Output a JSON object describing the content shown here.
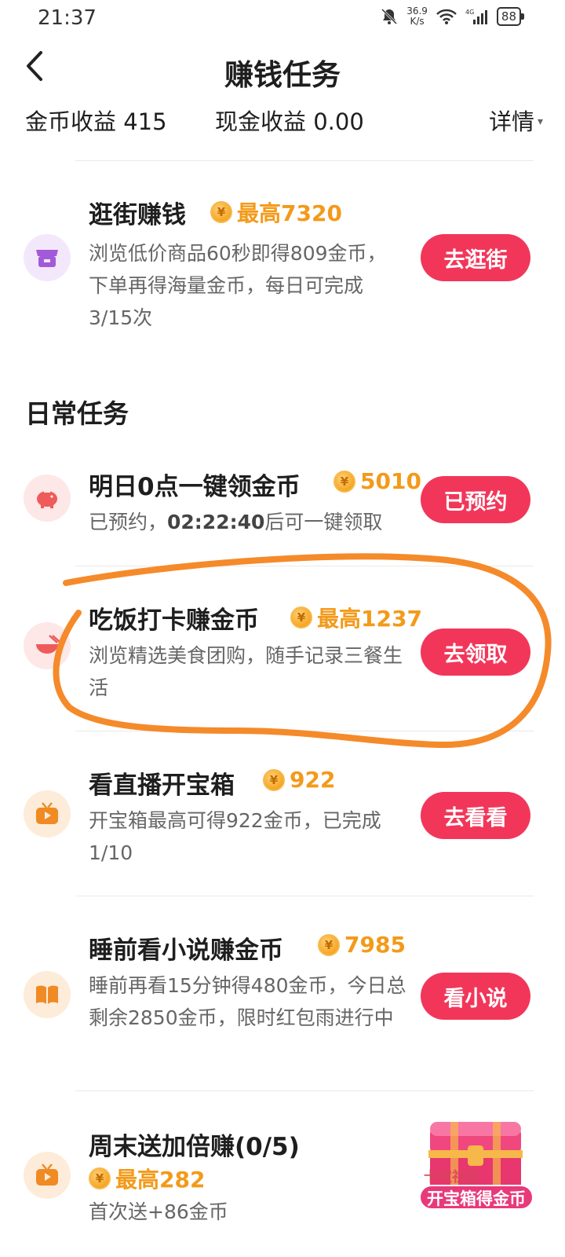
{
  "status_bar": {
    "time": "21:37",
    "net_speed_top": "36.9",
    "net_speed_bottom": "K/s",
    "network": "4G",
    "battery": "88"
  },
  "header": {
    "title": "赚钱任务"
  },
  "earnings": {
    "gold_label": "金币收益 415",
    "cash_label": "现金收益 0.00",
    "detail_label": "详情"
  },
  "top_task": {
    "name": "逛街赚钱",
    "reward": "最高7320",
    "desc": "浏览低价商品60秒即得809金币，下单再得海量金币，每日可完成3/15次",
    "button": "去逛街",
    "icon": "shop-icon"
  },
  "daily": {
    "title": "日常任务",
    "tasks": [
      {
        "name": "明日0点一键领金币",
        "reward": "5010",
        "desc_prefix": "已预约，",
        "desc_time": "02:22:40",
        "desc_suffix": "后可一键领取",
        "button": "已预约",
        "icon": "piggy-bank-icon"
      },
      {
        "name": "吃饭打卡赚金币",
        "reward": "最高1237",
        "desc": "浏览精选美食团购，随手记录三餐生活",
        "button": "去领取",
        "icon": "bowl-icon"
      },
      {
        "name": "看直播开宝箱",
        "reward": "922",
        "desc": "开宝箱最高可得922金币，已完成1/10",
        "button": "去看看",
        "icon": "tv-icon"
      },
      {
        "name": "睡前看小说赚金币",
        "reward": "7985",
        "desc": "睡前再看15分钟得480金币，今日总剩余2850金币，限时红包雨进行中",
        "button": "看小说",
        "icon": "book-icon"
      },
      {
        "name": "周末送加倍赚(0/5)",
        "reward": "最高282",
        "desc": "首次送+86金币",
        "icon": "tv-icon"
      }
    ]
  },
  "floating": {
    "label": "开宝箱得金币",
    "watermark": "卡农社区"
  },
  "colors": {
    "button": "#f2365a",
    "reward": "#f39a1a",
    "annotation": "#f58a2a"
  }
}
